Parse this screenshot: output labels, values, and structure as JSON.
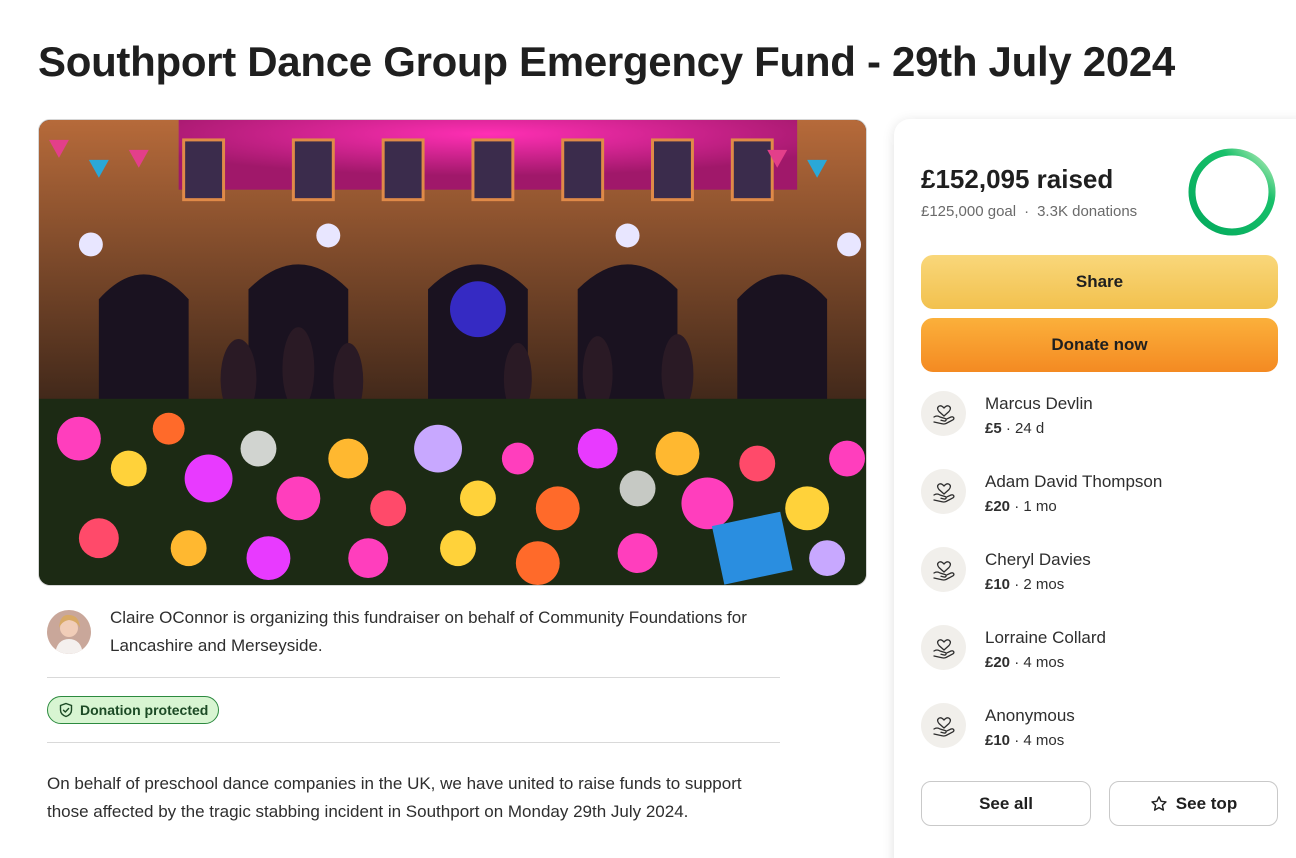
{
  "page": {
    "title": "Southport Dance Group Emergency Fund - 29th July 2024"
  },
  "organizer": {
    "text": "Claire OConnor is organizing this fundraiser on behalf of Community Foundations for Lancashire and Merseyside."
  },
  "badge": {
    "label": "Donation protected"
  },
  "story": {
    "text": "On behalf of preschool dance companies in the UK, we have united to raise funds to support those affected by the tragic stabbing incident in Southport on Monday 29th July 2024."
  },
  "donation_card": {
    "raised": "£152,095 raised",
    "goal": "£125,000 goal",
    "donations_count": "3.3K donations",
    "progress_fraction": 1.0,
    "share_label": "Share",
    "donate_label": "Donate now",
    "donors": [
      {
        "name": "Marcus Devlin",
        "amount": "£5",
        "time": "24 d"
      },
      {
        "name": "Adam David Thompson",
        "amount": "£20",
        "time": "1 mo"
      },
      {
        "name": "Cheryl Davies",
        "amount": "£10",
        "time": "2 mos"
      },
      {
        "name": "Lorraine Collard",
        "amount": "£20",
        "time": "4 mos"
      },
      {
        "name": "Anonymous",
        "amount": "£10",
        "time": "4 mos"
      }
    ],
    "see_all_label": "See all",
    "see_top_label": "See top"
  },
  "colors": {
    "share_button": "#f2c14e",
    "donate_button": "#f48a22",
    "progress_ring": "#02a95c",
    "badge_bg": "#d8f5d2"
  },
  "icons": {
    "badge": "shield-check-icon",
    "donor": "heart-hand-icon",
    "see_top": "star-icon"
  }
}
